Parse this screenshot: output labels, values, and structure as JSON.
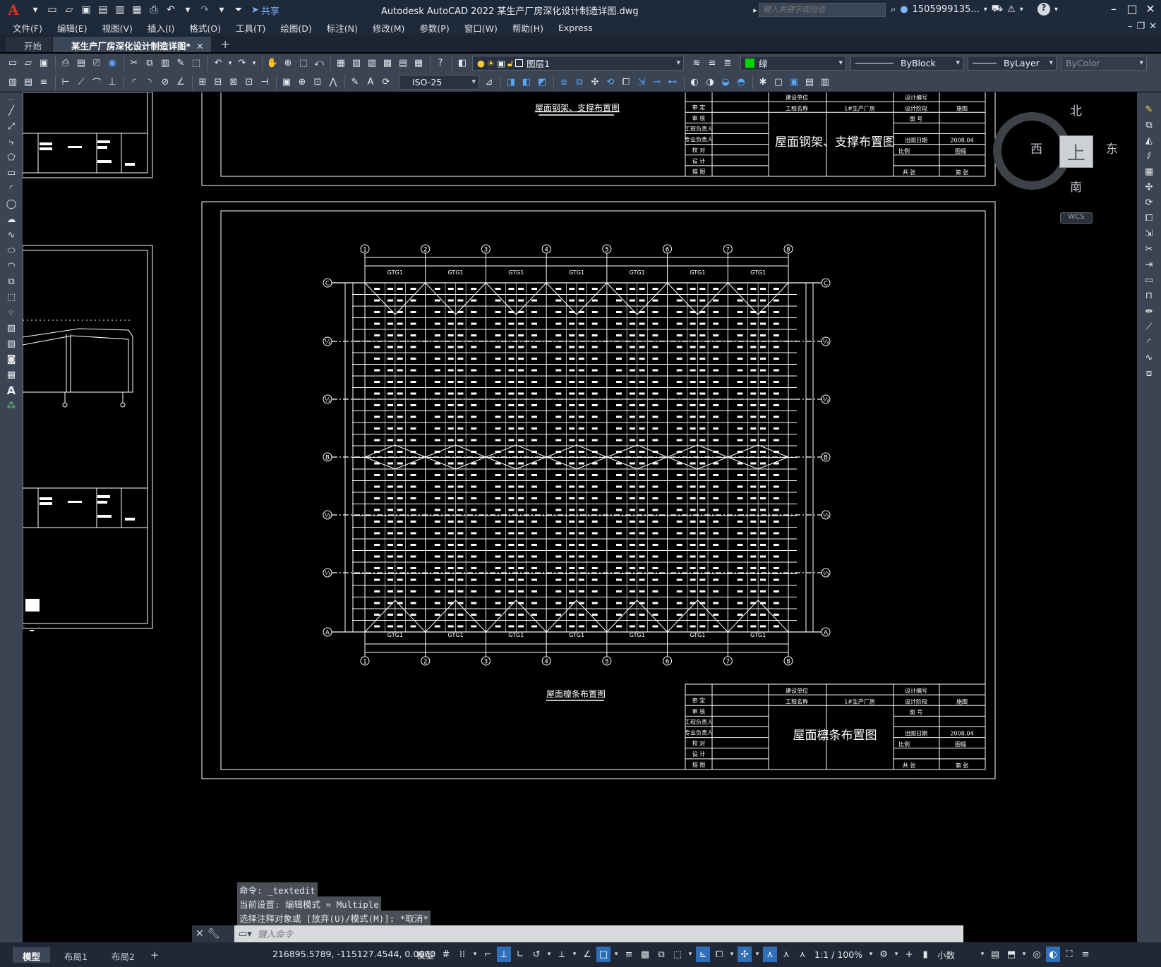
{
  "app": {
    "logo": "A",
    "title": "Autodesk AutoCAD 2022    某生产厂房深化设计制造详图.dwg",
    "share_label": "共享",
    "search_placeholder": "键入关键字或短语",
    "user": "1505999135...",
    "help": "?"
  },
  "menu": [
    "文件(F)",
    "编辑(E)",
    "视图(V)",
    "插入(I)",
    "格式(O)",
    "工具(T)",
    "绘图(D)",
    "标注(N)",
    "修改(M)",
    "参数(P)",
    "窗口(W)",
    "帮助(H)",
    "Express"
  ],
  "tabs": [
    {
      "label": "开始"
    },
    {
      "label": "某生产厂房深化设计制造详图*"
    }
  ],
  "toolbar": {
    "layer": "图层1",
    "color": "绿",
    "linetype": "ByBlock",
    "lineweight": "ByLayer",
    "plotstyle": "ByColor",
    "dimstyle": "ISO-25"
  },
  "viewcube": {
    "north": "北",
    "south": "南",
    "east": "东",
    "west": "西",
    "face": "上",
    "wcs": "WCS"
  },
  "drawing": {
    "sheet1_title": "屋面钢架、支撑布置图",
    "sheet1_tb_title": "屋面钢架、支撑布置图",
    "sheet2_title": "屋面檩条布置图",
    "sheet2_tb_title": "屋面檩条布置图",
    "tb_left": [
      "审 定",
      "审 核",
      "工程负责人",
      "专业负责人",
      "校 对",
      "设 计",
      "描 图"
    ],
    "tb_mid": [
      "建设单位",
      "工程名称",
      "1#生产厂房"
    ],
    "tb_right": [
      "设计编号",
      "设计阶段",
      "施图",
      "图 号",
      "出图日期",
      "2008.04",
      "比例",
      "图幅",
      "共 张",
      "第 张"
    ],
    "grid_cols": [
      "1",
      "2",
      "3",
      "4",
      "5",
      "6",
      "7",
      "8"
    ],
    "grid_rows": [
      "C",
      "B",
      "A"
    ],
    "frame_label": "GTG1"
  },
  "command": {
    "history": [
      "命令: _textedit",
      "当前设置: 编辑模式 = Multiple",
      "选择注释对象或 [放弃(U)/模式(M)]: *取消*"
    ],
    "placeholder": "键入命令"
  },
  "status": {
    "layouts": [
      "模型",
      "布局1",
      "布局2"
    ],
    "coords": "216895.5789, -115127.4544, 0.0000",
    "model": "模型",
    "scale": "1:1 / 100%",
    "units": "小数"
  }
}
